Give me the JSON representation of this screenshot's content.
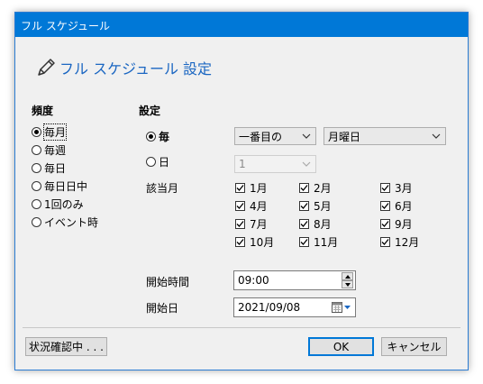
{
  "window": {
    "title": "フル スケジュール"
  },
  "heading": {
    "icon": "pencil-icon",
    "text": "フル スケジュール 設定",
    "color": "#1a66c2"
  },
  "frequency": {
    "label": "頻度",
    "options": [
      {
        "label": "毎月",
        "selected": true
      },
      {
        "label": "毎週",
        "selected": false
      },
      {
        "label": "毎日",
        "selected": false
      },
      {
        "label": "毎日日中",
        "selected": false
      },
      {
        "label": "1回のみ",
        "selected": false
      },
      {
        "label": "イベント時",
        "selected": false
      }
    ]
  },
  "settings": {
    "label": "設定",
    "every_option": {
      "label": "毎",
      "selected": true
    },
    "day_option": {
      "label": "日",
      "selected": false
    },
    "week_combo": {
      "value": "一番目の"
    },
    "weekday_combo": {
      "value": "月曜日"
    },
    "day_combo": {
      "value": "1",
      "disabled": true
    },
    "months_label": "該当月",
    "months": [
      {
        "label": "1月",
        "checked": true
      },
      {
        "label": "2月",
        "checked": true
      },
      {
        "label": "3月",
        "checked": true
      },
      {
        "label": "4月",
        "checked": true
      },
      {
        "label": "5月",
        "checked": true
      },
      {
        "label": "6月",
        "checked": true
      },
      {
        "label": "7月",
        "checked": true
      },
      {
        "label": "8月",
        "checked": true
      },
      {
        "label": "9月",
        "checked": true
      },
      {
        "label": "10月",
        "checked": true
      },
      {
        "label": "11月",
        "checked": true
      },
      {
        "label": "12月",
        "checked": true
      }
    ],
    "start_time_label": "開始時間",
    "start_time_value": "09:00",
    "start_date_label": "開始日",
    "start_date_value": "2021/09/08"
  },
  "buttons": {
    "status": "状況確認中 . . .",
    "ok": "OK",
    "cancel": "キャンセル"
  },
  "colors": {
    "titlebar": "#0078d7",
    "accent": "#1a66c2",
    "dialog_bg": "#f0f0f0"
  }
}
